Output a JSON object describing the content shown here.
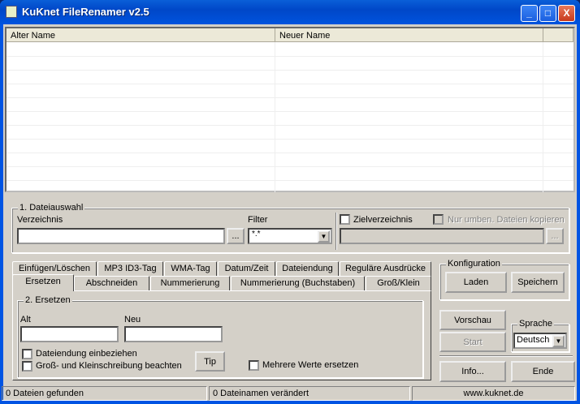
{
  "window": {
    "title": "KuKnet FileRenamer v2.5",
    "minimize": "_",
    "maximize": "□",
    "close": "X"
  },
  "list": {
    "columns": [
      "Alter Name",
      "Neuer Name"
    ]
  },
  "dateiauswahl": {
    "legend": "1. Dateiauswahl",
    "verzeichnis_label": "Verzeichnis",
    "verzeichnis_value": "",
    "browse": "...",
    "filter_label": "Filter",
    "filter_value": "*.*",
    "zielverzeichnis": "Zielverzeichnis",
    "nur_umben": "Nur umben. Dateien kopieren",
    "ziel_browse": "..."
  },
  "tabs_row1": [
    "Einfügen/Löschen",
    "MP3 ID3-Tag",
    "WMA-Tag",
    "Datum/Zeit",
    "Dateiendung",
    "Reguläre Ausdrücke"
  ],
  "tabs_row2": [
    "Ersetzen",
    "Abschneiden",
    "Nummerierung",
    "Nummerierung (Buchstaben)",
    "Groß/Klein"
  ],
  "ersetzen": {
    "legend": "2. Ersetzen",
    "alt_label": "Alt",
    "neu_label": "Neu",
    "alt_value": "",
    "neu_value": "",
    "dateiendung": "Dateiendung einbeziehen",
    "gross_klein": "Groß- und Kleinschreibung beachten",
    "tip": "Tip",
    "mehrere": "Mehrere Werte ersetzen"
  },
  "konfiguration": {
    "legend": "Konfiguration",
    "laden": "Laden",
    "speichern": "Speichern"
  },
  "actions": {
    "vorschau": "Vorschau",
    "start": "Start",
    "info": "Info...",
    "ende": "Ende"
  },
  "sprache": {
    "legend": "Sprache",
    "value": "Deutsch"
  },
  "status": {
    "found": "0 Dateien gefunden",
    "changed": "0 Dateinamen verändert",
    "url": "www.kuknet.de"
  }
}
